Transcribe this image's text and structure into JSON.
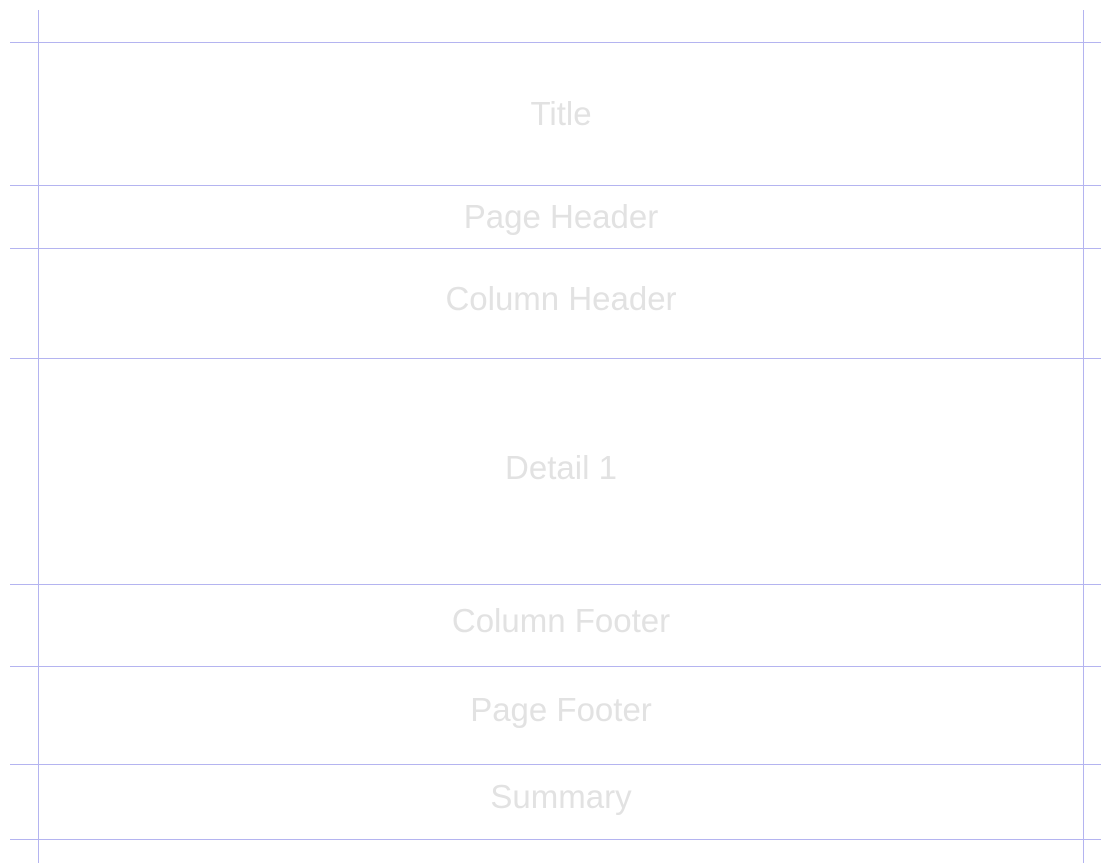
{
  "report": {
    "guide_color": "#b4b4f0",
    "label_color": "#e2e2e2",
    "bands": [
      {
        "id": "title",
        "label": "Title"
      },
      {
        "id": "page-header",
        "label": "Page Header"
      },
      {
        "id": "column-header",
        "label": "Column Header"
      },
      {
        "id": "detail-1",
        "label": "Detail 1"
      },
      {
        "id": "column-footer",
        "label": "Column Footer"
      },
      {
        "id": "page-footer",
        "label": "Page Footer"
      },
      {
        "id": "summary",
        "label": "Summary"
      }
    ]
  }
}
